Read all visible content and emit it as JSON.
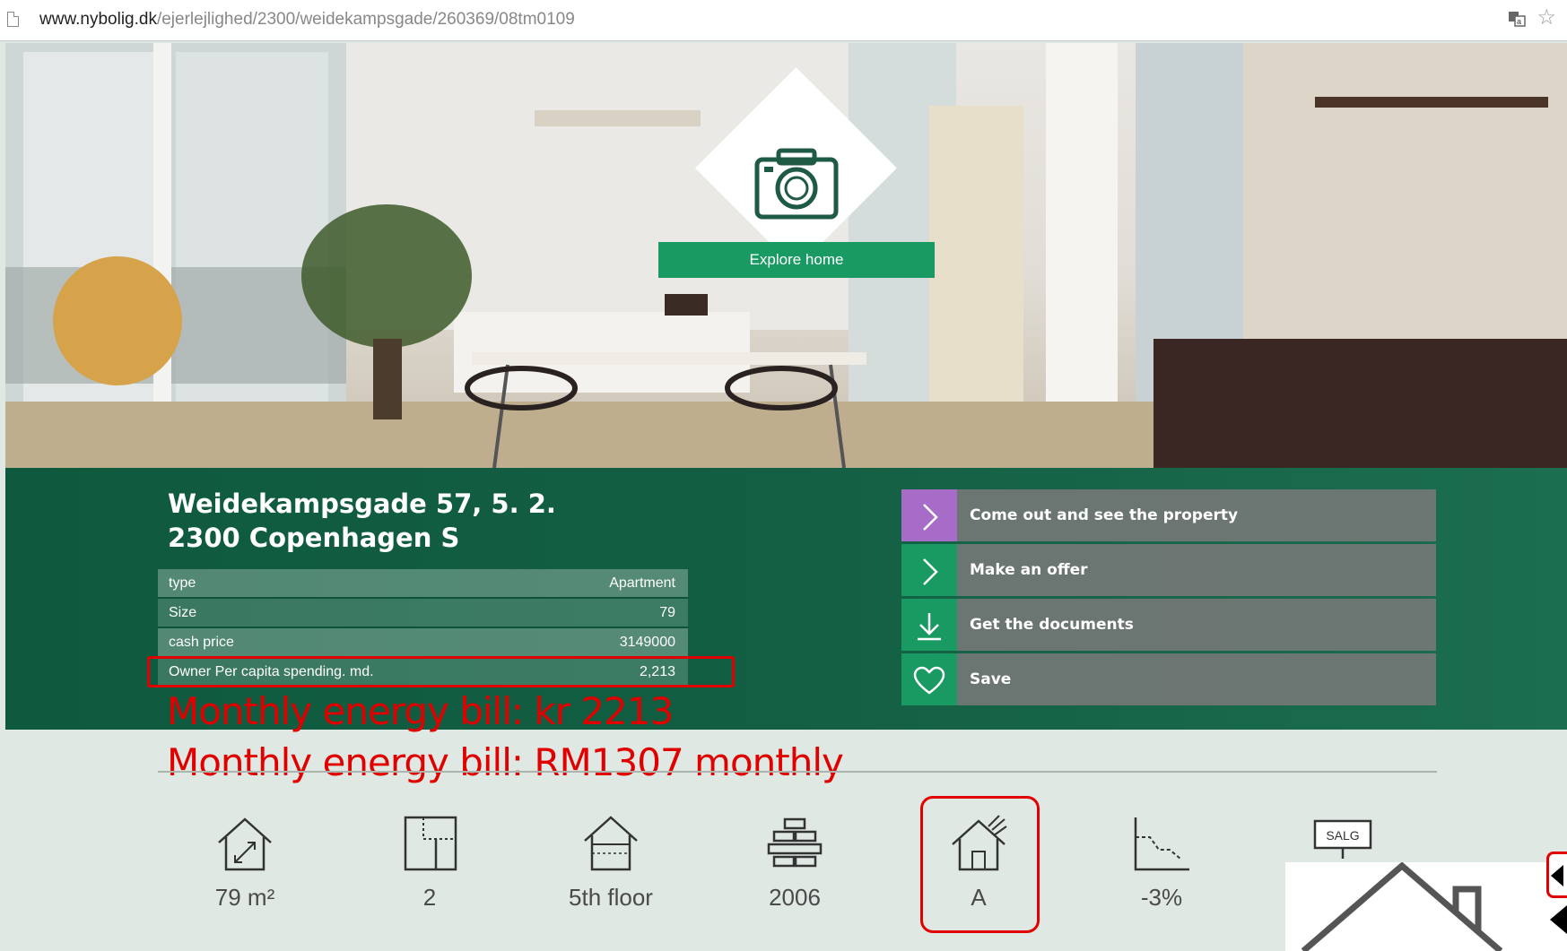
{
  "browser": {
    "url_host": "www.nybolig.dk",
    "url_path": "/ejerlejlighed/2300/weidekampsgade/260369/08tm0109"
  },
  "hero": {
    "explore_label": "Explore home"
  },
  "listing": {
    "address_line1": "Weidekampsgade 57, 5. 2.",
    "address_line2": "2300 Copenhagen S",
    "facts": [
      {
        "label": "type",
        "value": "Apartment"
      },
      {
        "label": "Size",
        "value": "79"
      },
      {
        "label": "cash price",
        "value": "3149000"
      },
      {
        "label": "Owner Per capita spending. md.",
        "value": "2,213"
      }
    ]
  },
  "annotations": {
    "line1": "Monthly energy bill:  kr 2213",
    "line2": "Monthly energy bill:  RM1307 monthly",
    "highlight_color": "#e00000"
  },
  "actions": [
    {
      "label": "Come out and see the property",
      "icon": "chevron-right-icon"
    },
    {
      "label": "Make an offer",
      "icon": "chevron-right-icon"
    },
    {
      "label": "Get the documents",
      "icon": "download-icon"
    },
    {
      "label": "Save",
      "icon": "heart-icon"
    }
  ],
  "stats": [
    {
      "value": "79 m²",
      "icon": "house-size-icon"
    },
    {
      "value": "2",
      "icon": "floorplan-rooms-icon"
    },
    {
      "value": "5th floor",
      "icon": "house-floor-icon"
    },
    {
      "value": "2006",
      "icon": "bricks-year-icon"
    },
    {
      "value": "A",
      "icon": "energy-label-house-icon"
    },
    {
      "value": "-3%",
      "icon": "price-drop-chart-icon"
    },
    {
      "value": "",
      "icon": "salg-sign-icon"
    }
  ],
  "stat_salg_text": "SALG",
  "colors": {
    "brand_green": "#1a9a63",
    "band_green": "#135f43",
    "accent_purple": "#a66cc8"
  }
}
